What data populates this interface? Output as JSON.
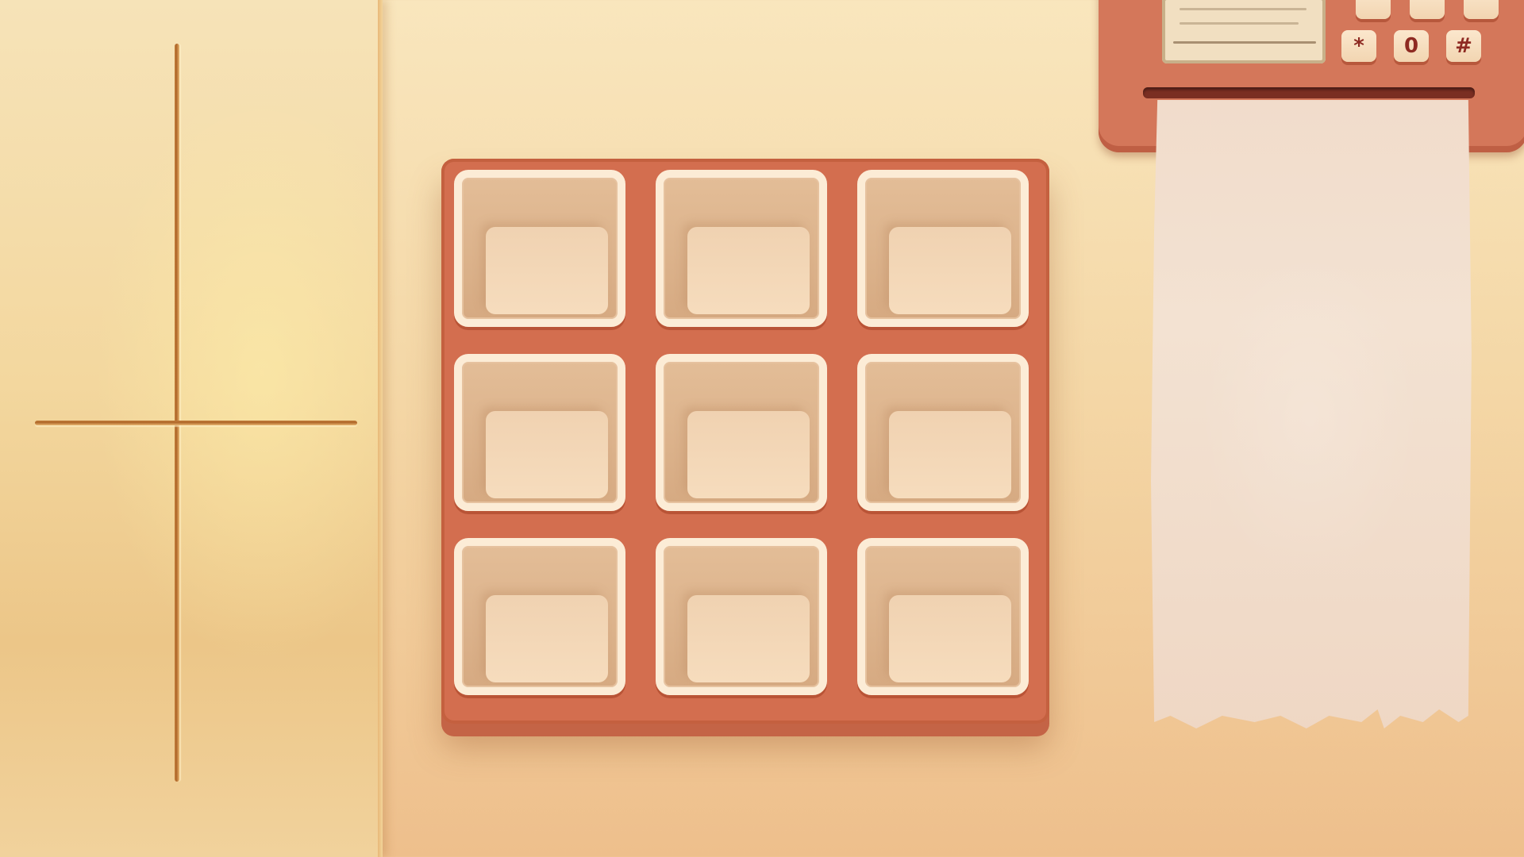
{
  "scene": {
    "background_color": "#f4d7a6",
    "tray_color": "#d36e4f",
    "slot_border_color": "#fcecd6",
    "phone_color": "#d4775a",
    "key_text_color": "#8e2a22",
    "receipt_color": "#f1dccb"
  },
  "tray": {
    "rows": 3,
    "columns": 3,
    "slots_filled": 0
  },
  "phone": {
    "keypad_visible": [
      "*",
      "0",
      "#"
    ]
  },
  "receipt": {
    "text": ""
  }
}
